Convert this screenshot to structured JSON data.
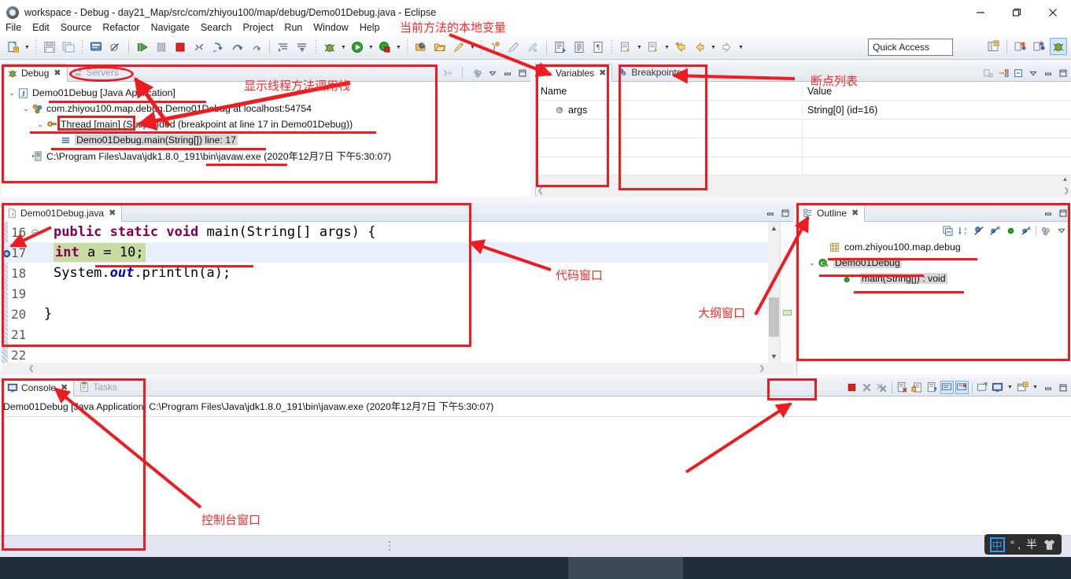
{
  "window": {
    "title": "workspace - Debug - day21_Map/src/com/zhiyou100/map/debug/Demo01Debug.java - Eclipse",
    "app_icon": "eclipse-icon",
    "minimize": "—",
    "maximize": "❐",
    "close": "✕"
  },
  "menubar": {
    "items": [
      {
        "label": "File"
      },
      {
        "label": "Edit"
      },
      {
        "label": "Source"
      },
      {
        "label": "Refactor"
      },
      {
        "label": "Navigate"
      },
      {
        "label": "Search"
      },
      {
        "label": "Project"
      },
      {
        "label": "Run"
      },
      {
        "label": "Window"
      },
      {
        "label": "Help"
      }
    ]
  },
  "toolbar": {
    "quick_access_placeholder": "Quick Access",
    "quick_access_value": "Quick Access"
  },
  "debug_view": {
    "tabs": [
      {
        "label": "Debug",
        "selected": true,
        "icon": "bug-icon",
        "close": "⌧"
      },
      {
        "label": "Servers",
        "selected": false,
        "icon": "servers-icon"
      }
    ],
    "tree": [
      {
        "depth": 0,
        "twisty": "⌄",
        "icon": "java-application-icon",
        "label": "Demo01Debug [Java Application]"
      },
      {
        "depth": 1,
        "twisty": "⌄",
        "icon": "debug-target-icon",
        "label": "com.zhiyou100.map.debug.Demo01Debug at localhost:54754"
      },
      {
        "depth": 2,
        "twisty": "⌄",
        "icon": "thread-icon",
        "label": "Thread [main] (Suspended (breakpoint at line 17 in Demo01Debug))"
      },
      {
        "depth": 3,
        "twisty": "",
        "icon": "stackframe-icon",
        "label": "Demo01Debug.main(String[]) line: 17",
        "selected": true
      },
      {
        "depth": 1,
        "twisty": "",
        "icon": "process-icon",
        "label": "C:\\Program Files\\Java\\jdk1.8.0_191\\bin\\javaw.exe (2020年12月7日 下午5:30:07)"
      }
    ]
  },
  "variables_view": {
    "tabs": [
      {
        "label": "Variables",
        "selected": true,
        "icon": "variables-icon",
        "close": "⌧"
      },
      {
        "label": "Breakpoints",
        "selected": false,
        "icon": "breakpoint-icon"
      }
    ],
    "columns": [
      "Name",
      "Value"
    ],
    "rows": [
      {
        "name": "args",
        "value": "String[0]  (id=16)",
        "icon": "object-icon"
      },
      {
        "name": "",
        "value": ""
      },
      {
        "name": "",
        "value": ""
      },
      {
        "name": "",
        "value": ""
      }
    ]
  },
  "editor": {
    "tabs": [
      {
        "label": "Demo01Debug.java",
        "selected": true,
        "icon": "java-file-icon",
        "close": "⌧"
      }
    ],
    "lines": [
      {
        "num": "16",
        "marker": "collapse",
        "indent": 4,
        "tokens": [
          {
            "t": "public",
            "c": "kw"
          },
          {
            "t": " ",
            "c": "plain"
          },
          {
            "t": "static",
            "c": "kw"
          },
          {
            "t": " ",
            "c": "plain"
          },
          {
            "t": "void",
            "c": "kw"
          },
          {
            "t": " main(String[] args) {",
            "c": "plain"
          }
        ]
      },
      {
        "num": "17",
        "marker": "breakpoint",
        "indent": 8,
        "current": true,
        "tokens": [
          {
            "t": "int",
            "c": "kw"
          },
          {
            "t": " a = ",
            "c": "plain"
          },
          {
            "t": "10",
            "c": "plain"
          },
          {
            "t": ";",
            "c": "plain"
          }
        ]
      },
      {
        "num": "18",
        "marker": "",
        "indent": 8,
        "tokens": [
          {
            "t": "System.",
            "c": "plain"
          },
          {
            "t": "out",
            "c": "fld"
          },
          {
            "t": ".println(a);",
            "c": "plain"
          }
        ]
      },
      {
        "num": "19",
        "marker": "",
        "indent": 0,
        "tokens": []
      },
      {
        "num": "20",
        "marker": "",
        "indent": 4,
        "tokens": [
          {
            "t": "}",
            "c": "plain"
          }
        ]
      },
      {
        "num": "21",
        "marker": "",
        "indent": 0,
        "tokens": []
      },
      {
        "num": "22",
        "marker": "",
        "indent": 0,
        "tokens": []
      }
    ]
  },
  "outline_view": {
    "tabs": [
      {
        "label": "Outline",
        "selected": true,
        "icon": "outline-icon",
        "close": "⌧"
      }
    ],
    "tree": [
      {
        "depth": 0,
        "twisty": "",
        "icon": "package-icon",
        "label": "com.zhiyou100.map.debug"
      },
      {
        "depth": 0,
        "twisty": "⌄",
        "icon": "class-icon",
        "label": "Demo01Debug",
        "selected": true
      },
      {
        "depth": 1,
        "twisty": "",
        "icon": "method-public-static-icon",
        "label": "main(String[]) : void",
        "selected": true
      }
    ]
  },
  "console_view": {
    "tabs": [
      {
        "label": "Console",
        "selected": true,
        "icon": "console-icon",
        "close": "⌧"
      },
      {
        "label": "Tasks",
        "selected": false,
        "icon": "tasks-icon"
      }
    ],
    "header_line": "Demo01Debug [Java Application] C:\\Program Files\\Java\\jdk1.8.0_191\\bin\\javaw.exe (2020年12月7日 下午5:30:07)",
    "body": ""
  },
  "annotations": {
    "local_variables": "当前方法的本地变量",
    "thread_call_stack": "显示线程方法调用栈",
    "breakpoint_list": "断点列表",
    "code_window": "代码窗口",
    "outline_window": "大纲窗口",
    "console_window": "控制台窗口",
    "color": "#fb2b2b"
  },
  "ime": {
    "mode": "中",
    "punct": "° ,",
    "currency": "半",
    "tray_icon": "shirt-icon"
  }
}
